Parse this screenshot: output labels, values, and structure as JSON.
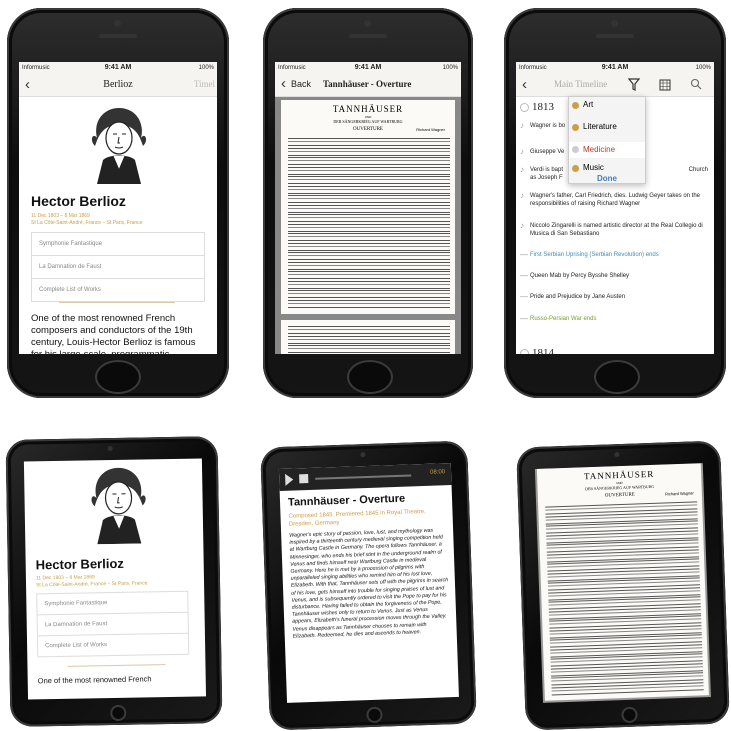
{
  "status": {
    "carrier": "Informusic",
    "time": "9:41 AM",
    "battery": "100%"
  },
  "p1": {
    "nav_title": "Berlioz",
    "nav_right": "Timel",
    "name": "Hector Berlioz",
    "dates": "11 Dec 1803 – 8 Mar 1869",
    "places": "St La Côte-Saint-André, France – St Paris, France",
    "works": [
      "Symphonie Fantastique",
      "La Damnation de Faust",
      "Complete List of Works"
    ],
    "bio": "One of the most renowned French composers and conductors of the 19th century, Louis-Hector Berlioz is famous for his large-scale, programmatic orchestral works, most notably,"
  },
  "p2": {
    "back": "Back",
    "title": "Tannhäuser - Overture",
    "score_title": "TANNHÄUSER",
    "score_sub1": "UND",
    "score_sub2": "DER SÄNGERKRIEG AUF WARTBURG",
    "score_ouv": "OUVERTURE",
    "score_composer": "Richard Wagner"
  },
  "p3": {
    "nav_title": "Main Timeline",
    "year": "1813",
    "menu": [
      {
        "label": "Art",
        "color": "#222222"
      },
      {
        "label": "Literature",
        "color": "#222222"
      },
      {
        "label": "Medicine",
        "color": "#c0392b"
      },
      {
        "label": "Music",
        "color": "#222222"
      }
    ],
    "done": "Done",
    "events": [
      {
        "icon": "♪",
        "text": "Wagner is bo",
        "color": "#222222"
      },
      {
        "icon": "♪",
        "text": "Giuseppe Ve",
        "color": "#222222"
      },
      {
        "icon": "♪",
        "text": "Verdi is bapt",
        "text2": "as Joseph F",
        "right": "Church",
        "color": "#222222"
      },
      {
        "icon": "♪",
        "text": "Wagner's father, Carl Friedrich, dies. Ludwig Geyer takes on the responsibilities of raising Richard Wagner",
        "color": "#222222"
      },
      {
        "icon": "♪",
        "text": "Niccolo Zingarelli is named artistic director at the Real Collegio di Musica di San Sebastiano",
        "color": "#222222"
      },
      {
        "icon": "—",
        "text": "First Serbian Uprising (Serbian Revolution) ends",
        "color": "#3a8fbf"
      },
      {
        "icon": "—",
        "text": "Queen Mab by Percy Bysshe Shelley",
        "color": "#222222"
      },
      {
        "icon": "—",
        "text": "Pride and Prejudice by Jane Austen",
        "color": "#222222"
      },
      {
        "icon": "—",
        "text": "Russo-Persian War ends",
        "color": "#7a9a2a"
      }
    ],
    "next_year": "1814"
  },
  "p4": {
    "name": "Hector Berlioz",
    "dates": "11 Dec 1803 – 8 Mar 1869",
    "places": "St La Côte-Saint-André, France – St Paris, France",
    "works": [
      "Symphonie Fantastique",
      "La Damnation de Faust",
      "Complete List of Works"
    ],
    "bio": "One of the most renowned French"
  },
  "p5": {
    "player_time": "08:00",
    "title": "Tannhäuser - Overture",
    "sub": "Composed 1845. Premiered 1845 in Royal Theatre, Dresden, Germany",
    "body": "Wagner's epic story of passion, love, lust, and mythology was inspired by a thirteenth century medieval singing competition held at Wartburg Castle in Germany. The opera follows Tannhäuser, a Minnesinger, who ends his brief stint in the underground realm of Venus and finds himself near Wartburg Castle in medieval Germany. Here he is met by a procession of pilgrims with unparalleled singing abilities who remind him of his lost love, Elizabeth. With that, Tannhäuser sets off with the pilgrims in search of his love, gets himself into trouble for singing praises of lust and Venus, and is subsequently ordered to visit the Pope to pay for his disturbance. Having failed to obtain the forgiveness of the Pope, Tannhäuser wishes only to return to Venus. Just as Venus appears, Elizabeth's funeral procession moves through the Valley. Venus disappears as Tannhäuser chooses to remain with Elizabeth. Redeemed, he dies and ascends to heaven."
  },
  "p6": {
    "score_title": "TANNHÄUSER",
    "score_sub1": "UND",
    "score_sub2": "DER SÄNGERKRIEG AUF WARTBURG",
    "score_ouv": "OUVERTURE",
    "score_composer": "Richard Wagner"
  }
}
